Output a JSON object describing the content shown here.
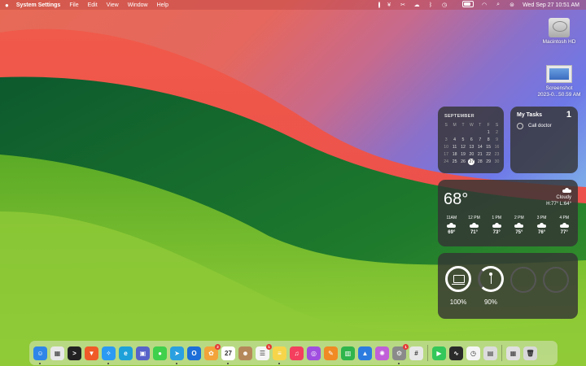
{
  "menubar": {
    "app_name": "System Settings",
    "menus": [
      "File",
      "Edit",
      "View",
      "Window",
      "Help"
    ],
    "clock": "Wed Sep 27  10:51 AM"
  },
  "desktop": {
    "icons": [
      {
        "label": "Macintosh HD"
      },
      {
        "label": "Screenshot\n2023-0...50.59 AM"
      }
    ]
  },
  "calendar": {
    "month": "SEPTEMBER",
    "weekdays": [
      "S",
      "M",
      "T",
      "W",
      "T",
      "F",
      "S"
    ],
    "weeks": [
      [
        "",
        "",
        "",
        "",
        "",
        "1",
        "2"
      ],
      [
        "3",
        "4",
        "5",
        "6",
        "7",
        "8",
        "9"
      ],
      [
        "10",
        "11",
        "12",
        "13",
        "14",
        "15",
        "16"
      ],
      [
        "17",
        "18",
        "19",
        "20",
        "21",
        "22",
        "23"
      ],
      [
        "24",
        "25",
        "26",
        "27",
        "28",
        "29",
        "30"
      ]
    ],
    "today": "27"
  },
  "tasks": {
    "title": "My Tasks",
    "count": "1",
    "items": [
      "Call doctor"
    ]
  },
  "weather": {
    "temp": "68°",
    "condition": "Cloudy",
    "hilo": "H:77° L:64°",
    "hours": [
      {
        "time": "11AM",
        "temp": "69°"
      },
      {
        "time": "12 PM",
        "temp": "71°"
      },
      {
        "time": "1 PM",
        "temp": "73°"
      },
      {
        "time": "2 PM",
        "temp": "75°"
      },
      {
        "time": "3 PM",
        "temp": "76°"
      },
      {
        "time": "4 PM",
        "temp": "77°"
      }
    ]
  },
  "batteries": [
    {
      "device": "laptop-icon",
      "percent": "100%",
      "level": 1.0
    },
    {
      "device": "pencil-icon",
      "percent": "90%",
      "level": 0.9
    }
  ],
  "dock": {
    "apps": [
      {
        "name": "finder",
        "color": "#2f86e8",
        "glyph": "☺"
      },
      {
        "name": "launchpad",
        "color": "#e8e8e8",
        "glyph": "▦"
      },
      {
        "name": "terminal",
        "color": "#222222",
        "glyph": ">"
      },
      {
        "name": "brave",
        "color": "#f05a28",
        "glyph": "▼"
      },
      {
        "name": "safari",
        "color": "#2b9af3",
        "glyph": "✧"
      },
      {
        "name": "edge",
        "color": "#1ea1d9",
        "glyph": "e"
      },
      {
        "name": "preview",
        "color": "#5863c9",
        "glyph": "▣"
      },
      {
        "name": "messages",
        "color": "#3fd04c",
        "glyph": "●"
      },
      {
        "name": "telegram",
        "color": "#2aa0e0",
        "glyph": "➤"
      },
      {
        "name": "outlook",
        "color": "#1d6ed8",
        "glyph": "O"
      },
      {
        "name": "photos",
        "color": "#f2a33a",
        "glyph": "✿"
      },
      {
        "name": "calendar",
        "color": "#ffffff",
        "glyph": "27"
      },
      {
        "name": "contacts",
        "color": "#b5885a",
        "glyph": "☻"
      },
      {
        "name": "reminders",
        "color": "#f5f5f5",
        "glyph": "☰"
      },
      {
        "name": "notes",
        "color": "#f7d54a",
        "glyph": "≡"
      },
      {
        "name": "music",
        "color": "#f43f5e",
        "glyph": "♫"
      },
      {
        "name": "podcasts",
        "color": "#a04ee0",
        "glyph": "◎"
      },
      {
        "name": "pages",
        "color": "#f08a24",
        "glyph": "✎"
      },
      {
        "name": "numbers",
        "color": "#2fb54c",
        "glyph": "▥"
      },
      {
        "name": "keynote",
        "color": "#2c7ce0",
        "glyph": "▲"
      },
      {
        "name": "flower-app",
        "color": "#c05fd8",
        "glyph": "✺"
      },
      {
        "name": "system-settings",
        "color": "#8a8a8a",
        "glyph": "⚙"
      },
      {
        "name": "slack",
        "color": "#e8e8e8",
        "glyph": "#"
      },
      {
        "name": "facetime",
        "color": "#34c759",
        "glyph": "▶"
      },
      {
        "name": "activity-monitor",
        "color": "#2a2a2a",
        "glyph": "∿"
      },
      {
        "name": "clock",
        "color": "#f5f5f5",
        "glyph": "◷"
      },
      {
        "name": "stickies",
        "color": "#dcdcdc",
        "glyph": "▤"
      },
      {
        "name": "downloads-stack",
        "color": "#e0e0e0",
        "glyph": "▦"
      },
      {
        "name": "trash",
        "color": "#d8d8d8",
        "glyph": "🗑"
      }
    ]
  }
}
